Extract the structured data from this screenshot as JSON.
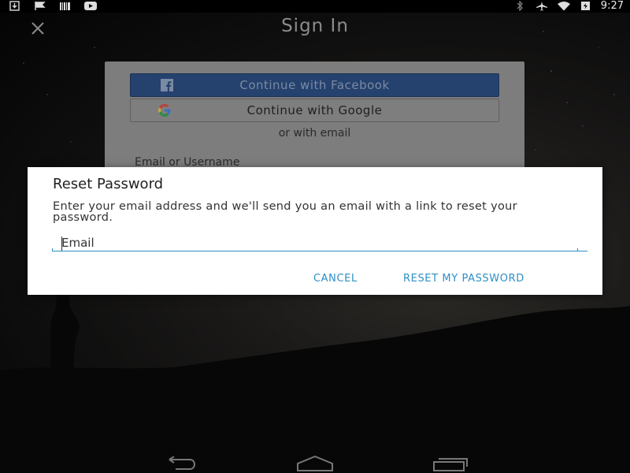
{
  "status_bar": {
    "time": "9:27",
    "left_icons": [
      "download-icon",
      "flag-icon",
      "barcode-icon",
      "youtube-icon"
    ],
    "right_icons": [
      "bluetooth-icon",
      "airplane-icon",
      "wifi-icon",
      "battery-icon"
    ]
  },
  "header": {
    "title": "Sign In",
    "close_icon": "close-icon"
  },
  "signin_card": {
    "facebook_label": "Continue with Facebook",
    "google_label": "Continue with Google",
    "or_email": "or with email",
    "email_username_label": "Email or Username",
    "colors": {
      "facebook": "#25416e",
      "card": "#7d7d7d"
    }
  },
  "dialog": {
    "title": "Reset Password",
    "message": "Enter your email address and we'll send you an email with a link to reset your password.",
    "email_placeholder": "Email",
    "email_value": "",
    "cancel_label": "CANCEL",
    "reset_label": "RESET MY PASSWORD",
    "colors": {
      "accent": "#2e8fc4"
    }
  },
  "nav_bar": {
    "icons": [
      "back-icon",
      "home-icon",
      "recents-icon"
    ]
  }
}
